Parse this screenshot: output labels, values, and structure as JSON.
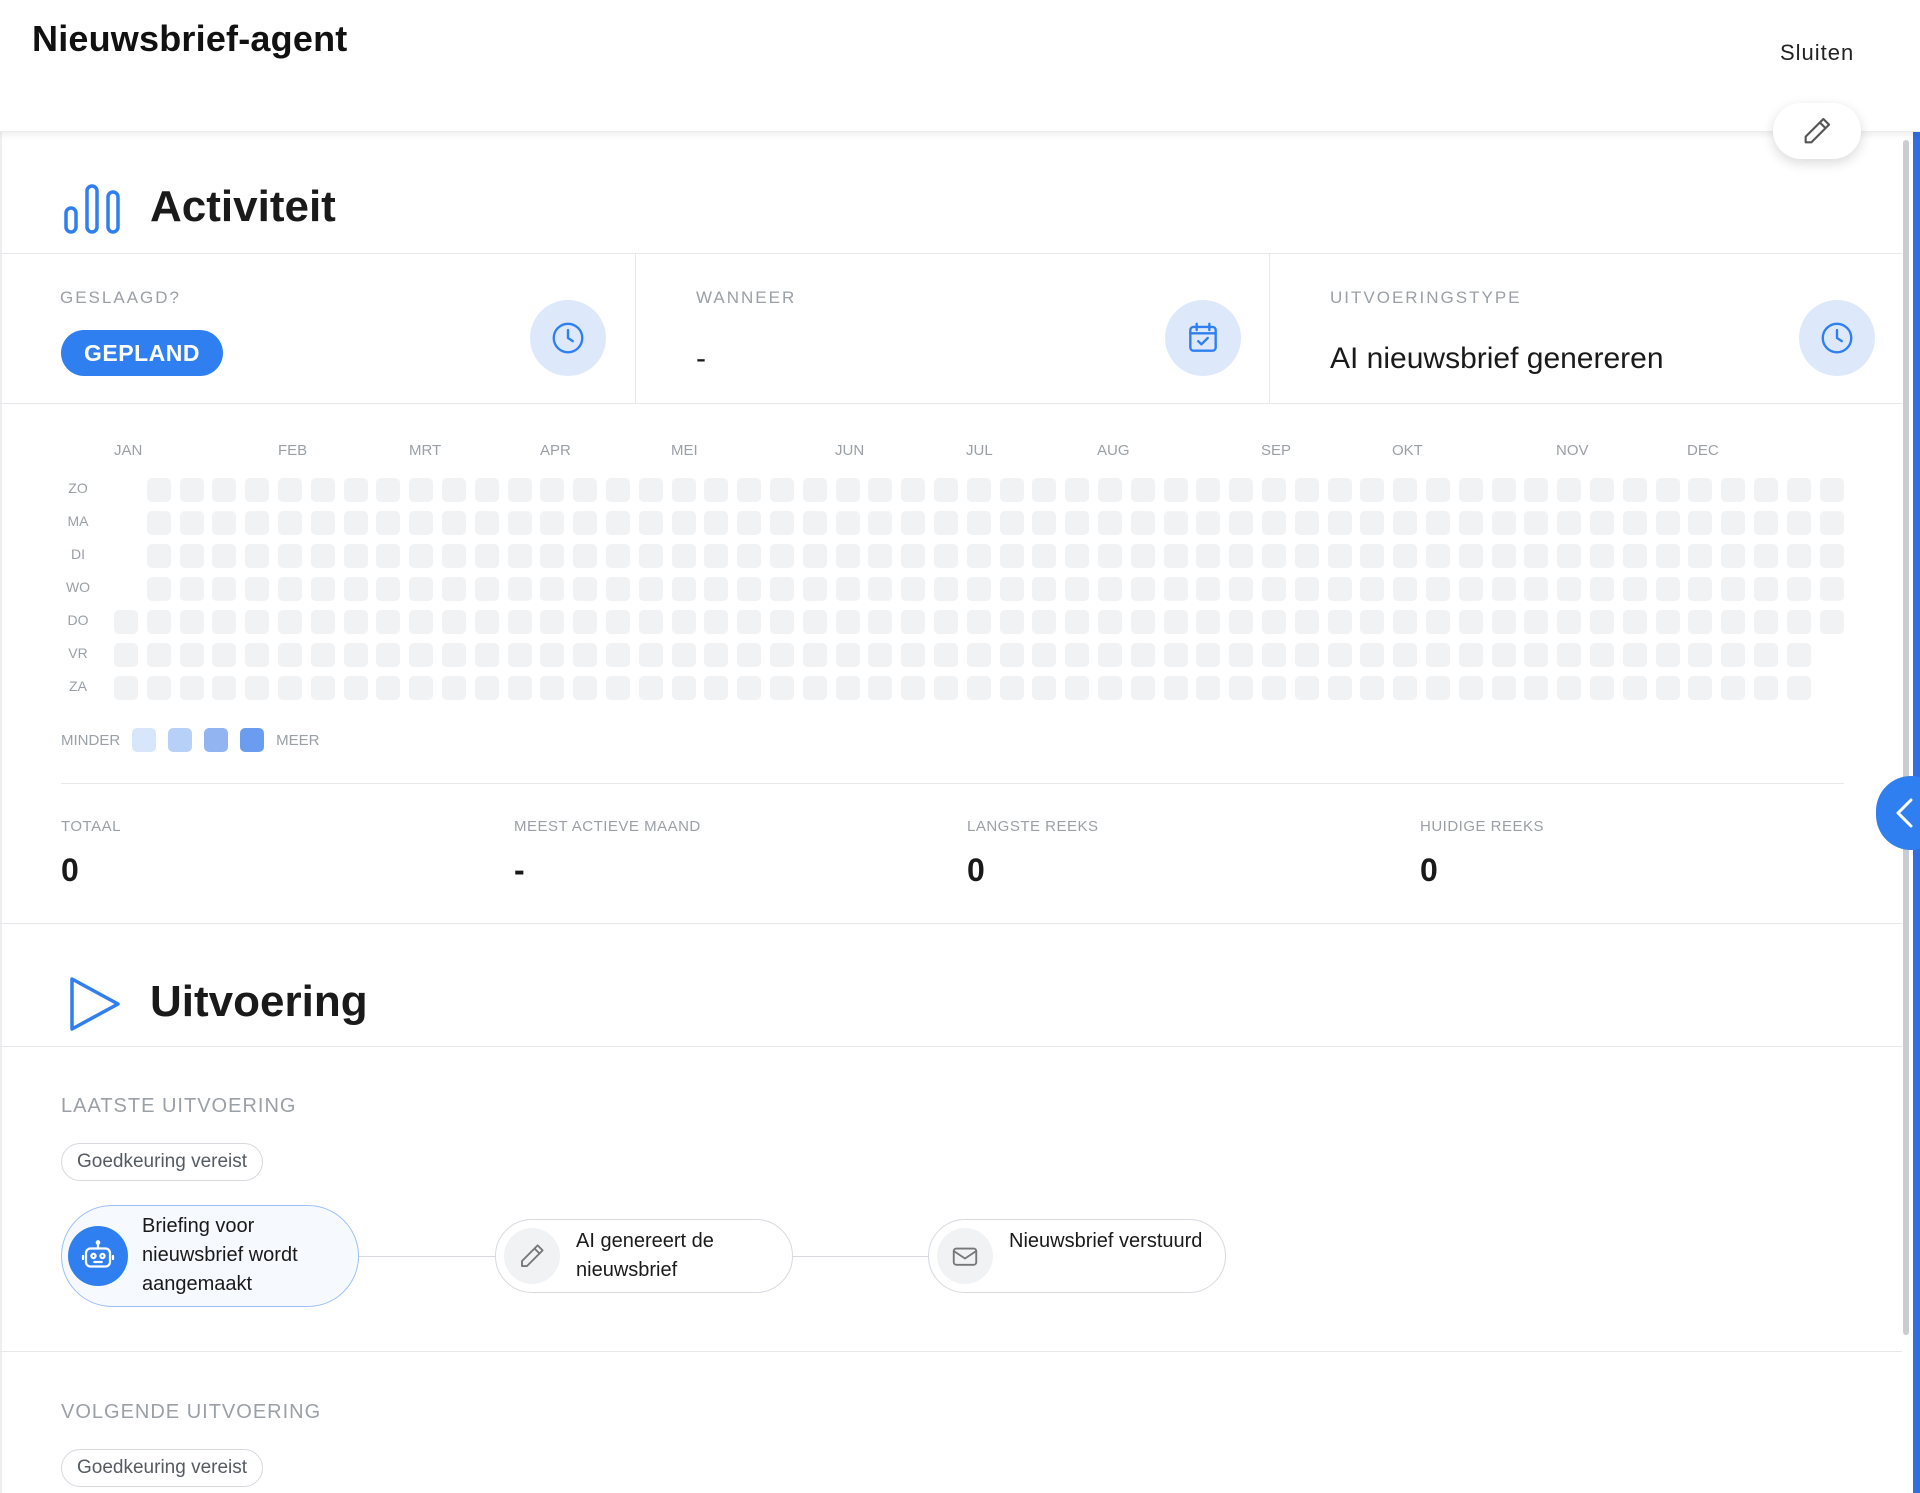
{
  "header": {
    "title": "Nieuwsbrief-agent",
    "close_label": "Sluiten",
    "edit_icon": "pencil-icon"
  },
  "activity": {
    "title": "Activiteit",
    "icon": "bar-chart-icon",
    "stats": [
      {
        "label": "GESLAAGD?",
        "badge": "GEPLAND",
        "icon": "clock-icon"
      },
      {
        "label": "WANNEER",
        "value": "-",
        "icon": "calendar-check-icon"
      },
      {
        "label": "UITVOERINGSTYPE",
        "value": "AI nieuwsbrief genereren",
        "icon": "clock-icon"
      }
    ],
    "heatmap": {
      "months": [
        "JAN",
        "FEB",
        "MRT",
        "APR",
        "MEI",
        "JUN",
        "JUL",
        "AUG",
        "SEP",
        "OKT",
        "NOV",
        "DEC"
      ],
      "days": [
        "ZO",
        "MA",
        "DI",
        "WO",
        "DO",
        "VR",
        "ZA"
      ],
      "legend_less": "MINDER",
      "legend_more": "MEER",
      "legend_colors": [
        "#d8e6fc",
        "#b6d0f8",
        "#92b5f1",
        "#6a9cf0"
      ],
      "empty_color": "#f1f2f4"
    },
    "totals": [
      {
        "label": "TOTAAL",
        "value": "0"
      },
      {
        "label": "MEEST ACTIEVE MAAND",
        "value": "-"
      },
      {
        "label": "LANGSTE REEKS",
        "value": "0"
      },
      {
        "label": "HUIDIGE REEKS",
        "value": "0"
      }
    ]
  },
  "execution": {
    "title": "Uitvoering",
    "icon": "play-icon",
    "last": {
      "label": "LAATSTE UITVOERING",
      "chip": "Goedkeuring vereist",
      "steps": [
        {
          "text": "Briefing voor nieuwsbrief wordt aangemaakt",
          "icon": "robot-icon",
          "state": "active"
        },
        {
          "text": "AI genereert de nieuwsbrief",
          "icon": "pencil-icon",
          "state": "pending"
        },
        {
          "text": "Nieuwsbrief verstuurd",
          "icon": "mail-icon",
          "state": "pending"
        }
      ]
    },
    "next": {
      "label": "VOLGENDE UITVOERING",
      "chip": "Goedkeuring vereist"
    }
  },
  "colors": {
    "accent": "#2f7ff0",
    "icon_bg": "#dde9fb",
    "muted_text": "#9aa0a6"
  }
}
